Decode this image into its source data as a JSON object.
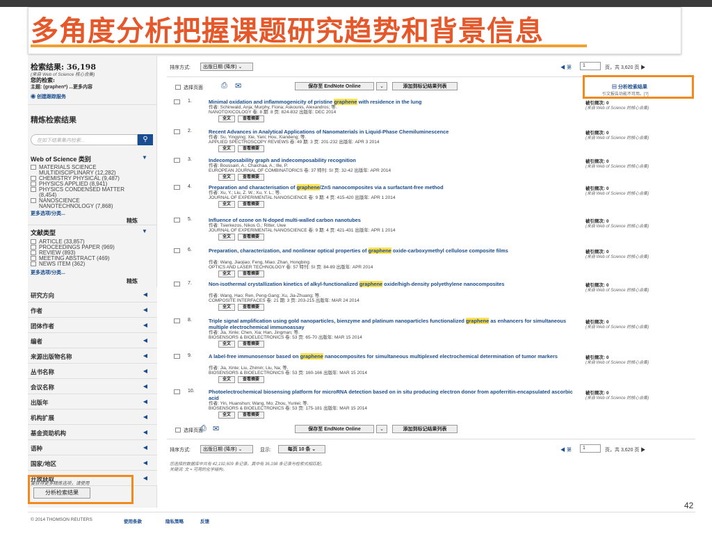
{
  "slide_title": "多角度分析把握课题研究趋势和背景信息",
  "page_number": "42",
  "sidebar": {
    "results_label": "检索结果: 36,198",
    "results_source": "(来自 Web of Science 核心合集)",
    "your_search_label": "您的检索:",
    "search_topic": "主题: (graphen*) ...更多内容",
    "alert_link": "创建跟踪服务",
    "refine_heading": "精炼检索结果",
    "refine_placeholder": "在如下结果集内检索...",
    "wos_category_heading": "Web of Science 类别",
    "wos_categories": [
      "MATERIALS SCIENCE",
      "MULTIDISCIPLINARY (12,282)",
      "CHEMISTRY PHYSICAL (9,487)",
      "PHYSICS APPLIED (8,941)",
      "PHYSICS CONDENSED MATTER",
      "(8,454)",
      "NANOSCIENCE",
      "NANOTECHNOLOGY (7,868)"
    ],
    "more_options": "更多选项/分类...",
    "refine_button": "精炼",
    "doc_type_heading": "文献类型",
    "doc_types": [
      "ARTICLE (33,857)",
      "PROCEEDINGS PAPER (969)",
      "REVIEW (893)",
      "MEETING ABSTRACT (469)",
      "NEWS ITEM (362)"
    ],
    "more_options2": "更多选项/分类...",
    "refine_button2": "精炼",
    "facets": [
      "研究方向",
      "作者",
      "团体作者",
      "编者",
      "来源出版物名称",
      "丛书名称",
      "会议名称",
      "出版年",
      "机构扩展",
      "基金资助机构",
      "语种",
      "国家/地区",
      "开放获取"
    ],
    "analysis_note": "要获得更多精炼选项，请使用",
    "analyze_button": "分析检索结果"
  },
  "toolbar": {
    "sort_label": "排序方式:",
    "sort_value": "出版日期 (降序)",
    "page_prefix": "◀ 第",
    "page_value": "1",
    "page_suffix": "页，共 3,620 页 ▶",
    "select_page": "选择页面",
    "save_button": "保存至 EndNote Online",
    "add_button": "添加到标记结果列表",
    "analyze_link": "分析检索结果",
    "citation_report": "引文报告功能不可用。[?]"
  },
  "records": [
    {
      "num": "1.",
      "title_pre": "Minimal oxidation and inflammogenicity of pristine ",
      "hl": "graphene",
      "title_post": " with residence in the lung",
      "authors": "作者: Schinwald, Anja; Murphy, Fiona; Askounis, Alexandros; 等.",
      "source": "NANOTOXICOLOGY  卷: 8  期: 8  页: 824-832  出版年: DEC 2014",
      "cites": "被引频次: 0"
    },
    {
      "num": "2.",
      "title_pre": "Recent Advances in Analytical Applications of Nanomaterials in Liquid-Phase Chemiluminescence",
      "hl": "",
      "title_post": "",
      "authors": "作者: Su, Yingying; Xie, Yani; Hou, Xiandeng; 等.",
      "source": "APPLIED SPECTROSCOPY REVIEWS  卷: 49  期: 3  页: 201-232  出版年: APR 3 2014",
      "cites": "被引频次: 0"
    },
    {
      "num": "3.",
      "title_pre": "Indecomposability graph and indecomposability recognition",
      "hl": "",
      "title_post": "",
      "authors": "作者: Boussairi, A.; Chaichaa, A.; Ille, P.",
      "source": "EUROPEAN JOURNAL OF COMBINATORICS  卷: 37  特刊: SI  页: 32-42  出版年: APR 2014",
      "cites": "被引频次: 0"
    },
    {
      "num": "4.",
      "title_pre": "Preparation and characterisation of ",
      "hl": "graphene",
      "title_post": "/ZnS nanocomposites via a surfactant-free method",
      "authors": "作者: Xu, Y.; Liu, Z. W.; Xu, Y. L.; 等.",
      "source": "JOURNAL OF EXPERIMENTAL NANOSCIENCE  卷: 9  期: 4  页: 415-420  出版年: APR 1 2014",
      "cites": "被引频次: 0"
    },
    {
      "num": "5.",
      "title_pre": "Influence of ozone on N-doped multi-walled carbon nanotubes",
      "hl": "",
      "title_post": "",
      "authors": "作者: Tsierkezos, Nikos G.; Ritter, Uwe",
      "source": "JOURNAL OF EXPERIMENTAL NANOSCIENCE  卷: 9  期: 4  页: 421-431  出版年: APR 1 2014",
      "cites": "被引频次: 0"
    },
    {
      "num": "6.",
      "title_pre": "Preparation, characterization, and nonlinear optical properties of ",
      "hl": "graphene",
      "title_post": " oxide-carboxymethyl cellulose composite films",
      "authors": "作者: Wang, Jiaojiao; Feng, Miao; Zhan, Hongbing",
      "source": "OPTICS AND LASER TECHNOLOGY  卷: 57  特刊: SI  页: 84-89  出版年: APR 2014",
      "cites": "被引频次: 0"
    },
    {
      "num": "7.",
      "title_pre": "Non-isothermal crystallization kinetics of alkyl-functionalized ",
      "hl": "graphene",
      "title_post": " oxide/high-density polyethylene nanocomposites",
      "authors": "作者: Wang, Hao; Ren, Peng-Gang; Xu, Jia-Zhuang; 等.",
      "source": "COMPOSITE INTERFACES  卷: 21  期: 3  页: 203-215  出版年: MAR 24 2014",
      "cites": "被引频次: 0"
    },
    {
      "num": "8.",
      "title_pre": "Triple signal amplification using gold nanoparticles, bienzyme and platinum nanoparticles functionalized ",
      "hl": "graphene",
      "title_post": " as enhancers for simultaneous multiple electrochemical immunoassay",
      "authors": "作者: Jia, Xinle; Chen, Xia; Han, Jingman; 等.",
      "source": "BIOSENSORS & BIOELECTRONICS  卷: 53  页: 65-70  出版年: MAR 15 2014",
      "cites": "被引频次: 0"
    },
    {
      "num": "9.",
      "title_pre": "A label-free immunosensor based on ",
      "hl": "graphene",
      "title_post": " nanocomposites for simultaneous multiplexed electrochemical determination of tumor markers",
      "authors": "作者: Jia, Xinle; Liu, Zhimin; Liu, Na; 等.",
      "source": "BIOSENSORS & BIOELECTRONICS  卷: 53  页: 160-166  出版年: MAR 15 2014",
      "cites": "被引频次: 0"
    },
    {
      "num": "10.",
      "title_pre": "Photoelectrochemical biosensing platform for microRNA detection based on in situ producing electron donor from apoferritin-encapsulated ascorbic acid",
      "hl": "",
      "title_post": "",
      "authors": "作者: Yin, Huanshun; Wang, Mo; Zhou, Yunlei; 等.",
      "source": "BIOSENSORS & BIOELECTRONICS  卷: 53  页: 175-181  出版年: MAR 15 2014",
      "cites": "被引频次: 0"
    }
  ],
  "record_labels": {
    "fulltext": "全文",
    "abstract": "查看摘要",
    "cite_source": "(来自 Web of Science 的核心合集)"
  },
  "bottom": {
    "sort_label": "排序方式:",
    "sort_value": "出版日期 (降序)",
    "show_label": "显示:",
    "show_value": "每页 10 条",
    "note1": "您选择的数据库中共有 42,192,609 条记录。其中有 36,198 条记录与检索式相匹配。",
    "note2": "关键词: 文 = 可用的化学结构。"
  },
  "footer": {
    "copyright": "© 2014  THOMSON REUTERS",
    "terms": "使用条款",
    "privacy": "隐私策略",
    "feedback": "反馈"
  },
  "colors": {
    "title": "#e4582a",
    "highlight_box": "#f08a1c",
    "link": "#1a4d8f",
    "search_highlight": "#ffe14d"
  }
}
